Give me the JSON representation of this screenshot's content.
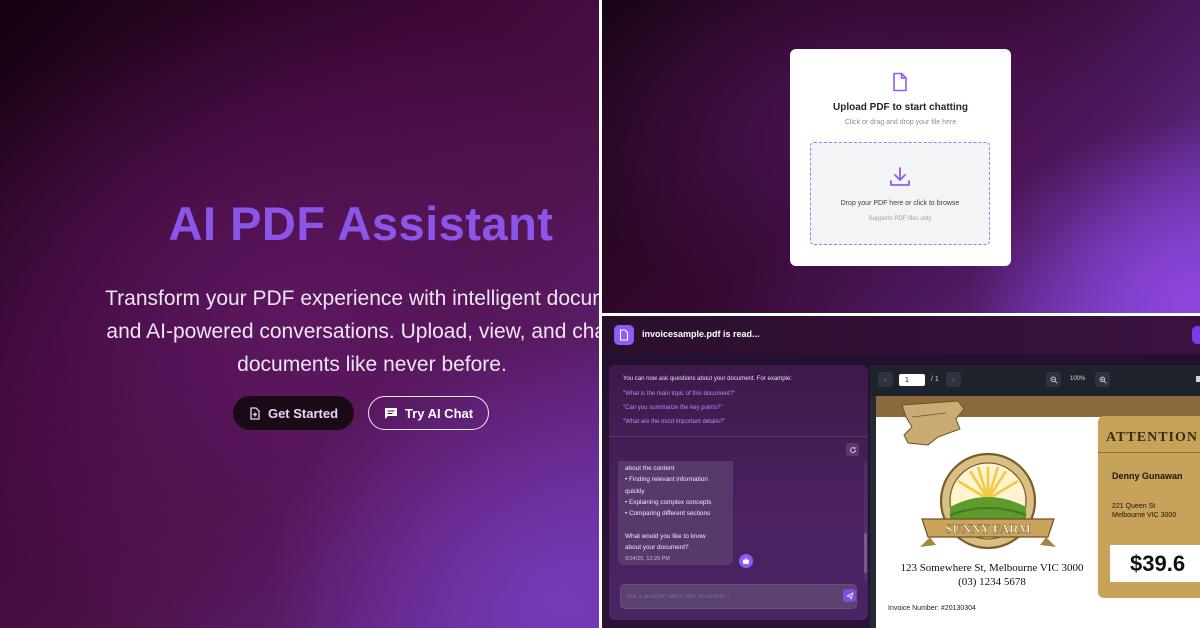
{
  "hero": {
    "title": "AI PDF Assistant",
    "subtitle_lines": [
      "Transform your PDF experience with intelligent document",
      "and AI-powered conversations. Upload, view, and chat wi",
      "documents like never before."
    ],
    "get_started_label": "Get Started",
    "try_chat_label": "Try AI Chat"
  },
  "upload": {
    "title": "Upload PDF to start chatting",
    "hint": "Click or drag and drop your file here",
    "drop_text": "Drop your PDF here or click to browse",
    "support_text": "Supports PDF files only"
  },
  "chat": {
    "header_title": "invoicesample.pdf is read...",
    "intro": "You can now ask questions about your document. For example:",
    "examples": [
      "\"What is the main topic of this document?\"",
      "\"Can you summarize the key points?\"",
      "\"What are the most important details?\""
    ],
    "message_lines": [
      "about the content",
      "• Finding relevant information",
      "quickly",
      "• Explaining complex concepts",
      "• Comparing different sections",
      "",
      "What would you like to know",
      "about your document?"
    ],
    "message_time": "9/24/25, 12:25 PM",
    "input_placeholder": "Ask a question about your document..."
  },
  "viewer": {
    "prev_icon": "chevron-left-icon",
    "next_icon": "chevron-right-icon",
    "page_value": "1",
    "page_total": "/ 1",
    "zoom_level": "100%",
    "invoice": {
      "attention": "ATTENTION",
      "recipient_name": "Denny Gunawan",
      "recipient_address": [
        "221 Queen St",
        "Melbourne VIC 3000"
      ],
      "amount": "$39.6",
      "farm_address": [
        "123 Somewhere St, Melbourne VIC 3000",
        "(03) 1234 5678"
      ],
      "invoice_number": "Invoice Number: #20130304",
      "logo_text": "SUNNY FARM"
    }
  },
  "colors": {
    "accent": "#8b5cf6",
    "hero_title": "#8b56e8",
    "invoice_gold": "#c6a25a"
  }
}
